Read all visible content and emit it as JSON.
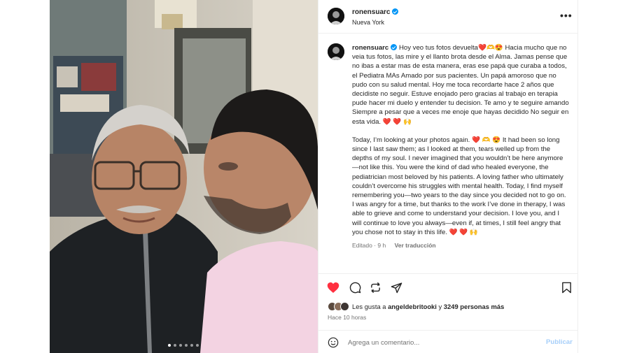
{
  "post": {
    "username": "ronensuarc",
    "location": "Nueva York",
    "more_icon": "more-horizontal-icon",
    "carousel": {
      "slide_count": 6,
      "active_index": 0
    }
  },
  "caption": {
    "username": "ronensuarc",
    "text_es": "Hoy veo tus fotos devuelta❤️🫶😍 Hacia mucho que no veia tus fotos, las mire y el llanto brota desde el Alma. Jamas pense que no ibas a estar mas de esta manera, eras ese papá que curaba a todos, el Pediatra MAs Amado por sus pacientes. Un papá amoroso que no pudo con su salud mental. Hoy me toca recordarte hace 2 años que decidiste no seguir. Estuve enojado pero gracias al trabajo en terapia pude hacer mi duelo y entender tu decision. Te amo y te seguire amando Siempre a pesar que a veces me enoje que hayas decidido No seguir en esta vida. ❤️ ❤️ 🙌",
    "text_en": "Today, I’m looking at your photos again. ❤️ 🫶 😍 It had been so long since I last saw them; as I looked at them, tears welled up from the depths of my soul. I never imagined that you wouldn’t be here anymore—not like this. You were the kind of dad who healed everyone, the pediatrician most beloved by his patients. A loving father who ultimately couldn’t overcome his struggles with mental health. Today, I find myself remembering you—two years to the day since you decided not to go on. I was angry for a time, but thanks to the work I’ve done in therapy, I was able to grieve and come to understand your decision. I love you, and I will continue to love you always—even if, at times, I still feel angry that you chose not to stay in this life. ❤️ ❤️ 🙌",
    "edited_label": "Editado · 9 h",
    "translate_label": "Ver traducción"
  },
  "actions": {
    "like_icon": "heart-filled-icon",
    "comment_icon": "comment-icon",
    "share_icon": "repost-icon",
    "send_icon": "send-icon",
    "save_icon": "bookmark-icon",
    "like_color": "#ff3040"
  },
  "likes": {
    "prefix": "Les gusta a ",
    "liker": "angeldebritooki",
    "middle": " y ",
    "count": "3249 personas más"
  },
  "timestamp": "Hace 10 horas",
  "comment_box": {
    "placeholder": "Agrega un comentario...",
    "publish_label": "Publicar",
    "emoji_icon": "emoji-smile-icon"
  },
  "colors": {
    "accent": "#0095f6",
    "publish_disabled": "#a6cffa",
    "muted": "#737373"
  }
}
